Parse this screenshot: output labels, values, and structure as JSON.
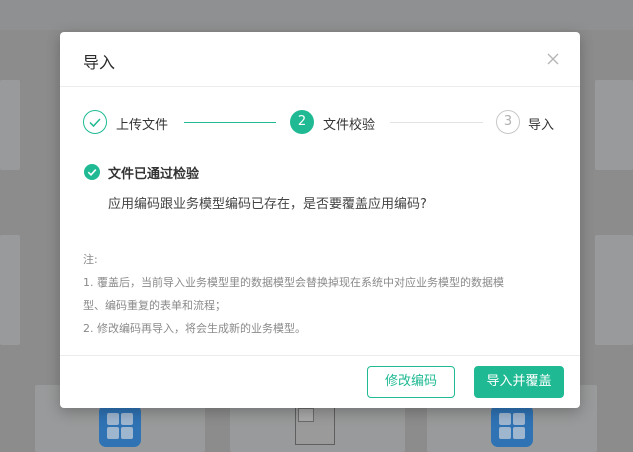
{
  "dialog": {
    "title": "导入",
    "close_icon": "close-icon"
  },
  "steps": [
    {
      "label": "上传文件",
      "number": "",
      "status": "finished",
      "icon": "check-icon"
    },
    {
      "label": "文件校验",
      "number": "2",
      "status": "active"
    },
    {
      "label": "导入",
      "number": "3",
      "status": "waiting"
    }
  ],
  "result": {
    "icon": "check-circle-icon",
    "title": "文件已通过检验",
    "question": "应用编码跟业务模型编码已存在，是否要覆盖应用编码?"
  },
  "notes": {
    "heading": "注:",
    "line1": "1. 覆盖后，当前导入业务模型里的数据模型会替换掉现在系统中对应业务模型的数据模",
    "line2": "型、编码重复的表单和流程；",
    "line3": "2. 修改编码再导入，将会生成新的业务模型。"
  },
  "footer": {
    "modify_label": "修改编码",
    "confirm_label": "导入并覆盖"
  },
  "colors": {
    "accent": "#1fba93",
    "overlay": "#8c8c8c",
    "app_icon": "#2f73b5"
  }
}
